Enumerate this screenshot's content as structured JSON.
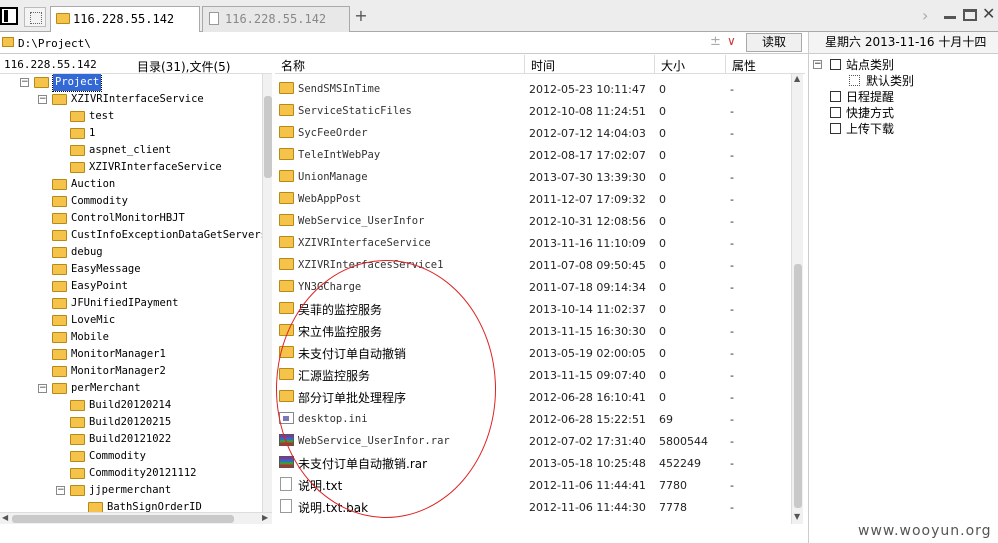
{
  "tabs": [
    {
      "label": "116.228.55.142",
      "active": true
    },
    {
      "label": "116.228.55.142",
      "active": false
    }
  ],
  "new_tab": "+",
  "window": {
    "forward": "›",
    "close": "✕"
  },
  "path_bar": {
    "path": "D:\\Project\\",
    "plus": "±",
    "dropdown": "∨",
    "go_label": "读取"
  },
  "left_panel": {
    "host": "116.228.55.142",
    "count": "目录(31),文件(5)",
    "tree": [
      {
        "label": "Project",
        "expanded": true,
        "selected": true
      },
      {
        "label": "XZIVRInterfaceService",
        "expanded": true
      },
      {
        "label": "test"
      },
      {
        "label": "1"
      },
      {
        "label": "aspnet_client"
      },
      {
        "label": "XZIVRInterfaceService"
      },
      {
        "label": "Auction"
      },
      {
        "label": "Commodity"
      },
      {
        "label": "ControlMonitorHBJT"
      },
      {
        "label": "CustInfoExceptionDataGetServers"
      },
      {
        "label": "debug"
      },
      {
        "label": "EasyMessage"
      },
      {
        "label": "EasyPoint"
      },
      {
        "label": "JFUnifiedIPayment"
      },
      {
        "label": "LoveMic"
      },
      {
        "label": "Mobile"
      },
      {
        "label": "MonitorManager1"
      },
      {
        "label": "MonitorManager2"
      },
      {
        "label": "perMerchant",
        "expanded": true
      },
      {
        "label": "Build20120214"
      },
      {
        "label": "Build20120215"
      },
      {
        "label": "Build20121022"
      },
      {
        "label": "Commodity"
      },
      {
        "label": "Commodity20121112"
      },
      {
        "label": "jjpermerchant",
        "expanded": true
      },
      {
        "label": "BathSignOrderID"
      }
    ]
  },
  "file_list": {
    "columns": {
      "name": "名称",
      "time": "时间",
      "size": "大小",
      "attr": "属性"
    },
    "rows": [
      {
        "name": "SendSMSInTime",
        "type": "folder",
        "time": "2012-05-23 10:11:47",
        "size": "0",
        "attr": "-"
      },
      {
        "name": "ServiceStaticFiles",
        "type": "folder",
        "time": "2012-10-08 11:24:51",
        "size": "0",
        "attr": "-"
      },
      {
        "name": "SycFeeOrder",
        "type": "folder",
        "time": "2012-07-12 14:04:03",
        "size": "0",
        "attr": "-"
      },
      {
        "name": "TeleIntWebPay",
        "type": "folder",
        "time": "2012-08-17 17:02:07",
        "size": "0",
        "attr": "-"
      },
      {
        "name": "UnionManage",
        "type": "folder",
        "time": "2013-07-30 13:39:30",
        "size": "0",
        "attr": "-"
      },
      {
        "name": "WebAppPost",
        "type": "folder",
        "time": "2011-12-07 17:09:32",
        "size": "0",
        "attr": "-"
      },
      {
        "name": "WebService_UserInfor",
        "type": "folder",
        "time": "2012-10-31 12:08:56",
        "size": "0",
        "attr": "-"
      },
      {
        "name": "XZIVRInterfaceService",
        "type": "folder",
        "time": "2013-11-16 11:10:09",
        "size": "0",
        "attr": "-"
      },
      {
        "name": "XZIVRInterfacesService1",
        "type": "folder",
        "time": "2011-07-08 09:50:45",
        "size": "0",
        "attr": "-"
      },
      {
        "name": "YN3GCharge",
        "type": "folder",
        "time": "2011-07-18 09:14:34",
        "size": "0",
        "attr": "-"
      },
      {
        "name": "吴菲的监控服务",
        "type": "folder",
        "time": "2013-10-14 11:02:37",
        "size": "0",
        "attr": "-"
      },
      {
        "name": "宋立伟监控服务",
        "type": "folder",
        "time": "2013-11-15 16:30:30",
        "size": "0",
        "attr": "-"
      },
      {
        "name": "未支付订单自动撤销",
        "type": "folder",
        "time": "2013-05-19 02:00:05",
        "size": "0",
        "attr": "-"
      },
      {
        "name": "汇源监控服务",
        "type": "folder",
        "time": "2013-11-15 09:07:40",
        "size": "0",
        "attr": "-"
      },
      {
        "name": "部分订单批处理程序",
        "type": "folder",
        "time": "2012-06-28 16:10:41",
        "size": "0",
        "attr": "-"
      },
      {
        "name": "desktop.ini",
        "type": "ini",
        "time": "2012-06-28 15:22:51",
        "size": "69",
        "attr": "-"
      },
      {
        "name": "WebService_UserInfor.rar",
        "type": "rar",
        "time": "2012-07-02 17:31:40",
        "size": "5800544",
        "attr": "-"
      },
      {
        "name": "未支付订单自动撤销.rar",
        "type": "rar",
        "time": "2013-05-18 10:25:48",
        "size": "452249",
        "attr": "-"
      },
      {
        "name": "说明.txt",
        "type": "txt",
        "time": "2012-11-06 11:44:41",
        "size": "7780",
        "attr": "-"
      },
      {
        "name": "说明.txt.bak",
        "type": "txt",
        "time": "2012-11-06 11:44:30",
        "size": "7778",
        "attr": "-"
      }
    ]
  },
  "right_panel": {
    "date": "星期六 2013-11-16 十月十四",
    "items": [
      {
        "label": "站点类别",
        "icon": "site-category-icon"
      },
      {
        "label": "默认类别",
        "icon": "default-category-icon"
      },
      {
        "label": "日程提醒",
        "icon": "schedule-icon"
      },
      {
        "label": "快捷方式",
        "icon": "shortcut-icon"
      },
      {
        "label": "上传下载",
        "icon": "transfer-icon"
      }
    ]
  },
  "watermark": "www.wooyun.org"
}
